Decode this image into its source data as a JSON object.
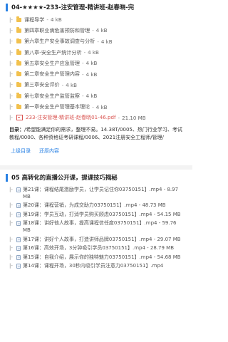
{
  "section1": {
    "title": "04-★★★★-233-注安管理-精讲班-赵春晓-完",
    "files": [
      {
        "prefix": "|-",
        "type": "folder",
        "name": "课程导学",
        "size": "4 kB"
      },
      {
        "prefix": "|-",
        "type": "folder",
        "name": "第四章职业病危害预防和管理",
        "size": "4 kB"
      },
      {
        "prefix": "|-",
        "type": "folder",
        "name": "第六章生产安全事故调查与分析",
        "size": "4 kB"
      },
      {
        "prefix": "|-",
        "type": "folder",
        "name": "第八章-安全生产统计分析",
        "size": "4 kB"
      },
      {
        "prefix": "|-",
        "type": "folder",
        "name": "第五章安全生产应急管理",
        "size": "4 kB"
      },
      {
        "prefix": "|-",
        "type": "folder",
        "name": "第二章安全生产管理内容",
        "size": "4 kB"
      },
      {
        "prefix": "|-",
        "type": "folder",
        "name": "第三章安全评价",
        "size": "4 kB"
      },
      {
        "prefix": "|-",
        "type": "folder",
        "name": "第七章安全生产监管监察",
        "size": "4 kB"
      },
      {
        "prefix": "|-",
        "type": "folder",
        "name": "第一章安全生产管理基本理论",
        "size": "4 kB"
      },
      {
        "prefix": "|-",
        "type": "pdf",
        "name": "233-注安管理-精讲班-赵春晓01-46.pdf",
        "size": "21.10 MB"
      }
    ],
    "desc_label": "目录：",
    "desc_text": "/希望能满足你的需求，整理不易。14.38T/0005、热门行业学习、考试教程/0000、各种资格证考研课程/0006、2021注册安全工程师/管理/",
    "btn_top": "上级目录",
    "btn_back": "还原内容"
  },
  "section2": {
    "title": "05 高转化的直播公开课，提课技巧揭秘",
    "items": [
      {
        "prefix": "|-",
        "text": "第21课：课程结尾激励学员，让学员记住你03750151】.mp4 - 8.97 MB"
      },
      {
        "prefix": "|-",
        "text": "第20课：课程营销，为成交助力03750151】.mp4 - 48.73 MB"
      },
      {
        "prefix": "|-",
        "text": "第19课：学员互动，打消学员购买顾虑03750151】.mp4 - 54.15 MB"
      },
      {
        "prefix": "|-",
        "text": "第18课：讲好他人故事，提高课程信任度03750151】.mp4 - 59.76 MB"
      },
      {
        "prefix": "|-",
        "text": "第17课：讲好个人故事，打造讲师品牌03750151】.mp4 - 29.07 MB"
      },
      {
        "prefix": "|-",
        "text": "第16课：高效开场，3分钟吸引学员03750151】.mp4 - 28.79 MB"
      },
      {
        "prefix": "|-",
        "text": "第15课：自我介绍，展示你的独特魅力03750151】.mp4 - 54.68 MB"
      },
      {
        "prefix": "|-",
        "text": "第14课：课程开场，30秒内吸引学员注意力03750151】.mp4"
      }
    ]
  }
}
